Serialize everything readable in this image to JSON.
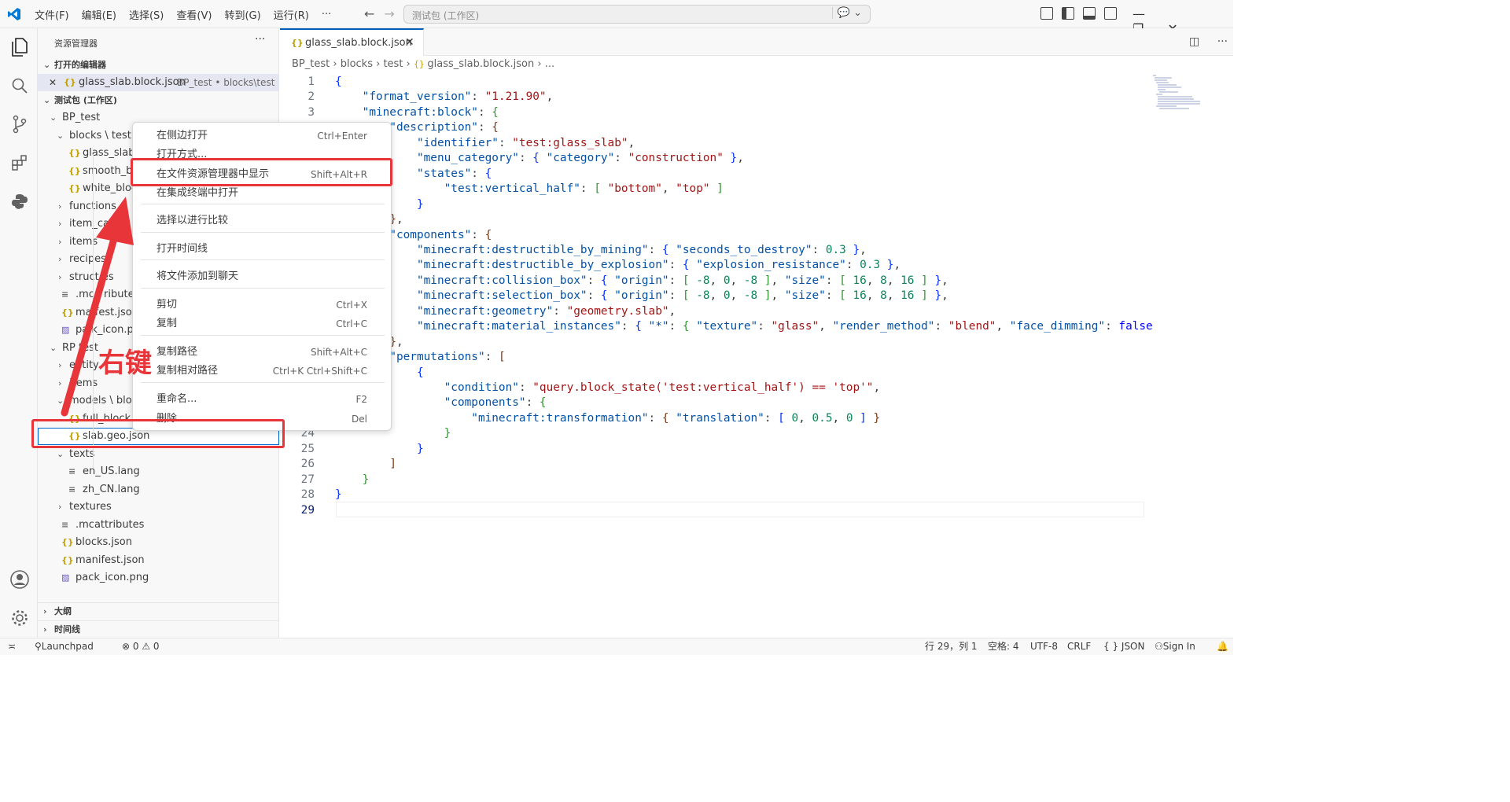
{
  "menu": [
    "文件(F)",
    "编辑(E)",
    "选择(S)",
    "查看(V)",
    "转到(G)",
    "运行(R)",
    "···"
  ],
  "search_placeholder": "测试包 (工作区)",
  "sidebar": {
    "title": "资源管理器",
    "more": "···",
    "open_editors": "打开的编辑器",
    "open_file": "glass_slab.block.json",
    "open_file_path": "BP_test • blocks\\test",
    "workspace": "测试包 (工作区)",
    "tree": [
      {
        "label": "BP_test",
        "kind": "folder-open",
        "indent": 1
      },
      {
        "label": "blocks \\ test",
        "kind": "folder-open",
        "indent": 2
      },
      {
        "label": "glass_slab.bl",
        "kind": "json",
        "indent": 3
      },
      {
        "label": "smooth_blo",
        "kind": "json",
        "indent": 3
      },
      {
        "label": "white_block.",
        "kind": "json",
        "indent": 3
      },
      {
        "label": "functions",
        "kind": "folder",
        "indent": 2
      },
      {
        "label": "item_ca",
        "kind": "folder",
        "indent": 2
      },
      {
        "label": "items",
        "kind": "folder",
        "indent": 2
      },
      {
        "label": "recipes",
        "kind": "folder",
        "indent": 2
      },
      {
        "label": "struct  es",
        "kind": "folder",
        "indent": 2
      },
      {
        "label": ".mca  ributes",
        "kind": "file",
        "indent": 2
      },
      {
        "label": "ma  fest.json",
        "kind": "json",
        "indent": 2
      },
      {
        "label": "pa  k_icon.png",
        "kind": "img",
        "indent": 2
      },
      {
        "label": "RP  test",
        "kind": "folder-open",
        "indent": 1
      },
      {
        "label": "entity",
        "kind": "folder",
        "indent": 2
      },
      {
        "label": "items",
        "kind": "folder",
        "indent": 2
      },
      {
        "label": "models \\ block",
        "kind": "folder-open",
        "indent": 2
      },
      {
        "label": "full_block.ge",
        "kind": "json",
        "indent": 3
      },
      {
        "label": "slab.geo.json",
        "kind": "json",
        "indent": 3
      },
      {
        "label": "texts",
        "kind": "folder-open",
        "indent": 2
      },
      {
        "label": "en_US.lang",
        "kind": "file",
        "indent": 3
      },
      {
        "label": "zh_CN.lang",
        "kind": "file",
        "indent": 3
      },
      {
        "label": "textures",
        "kind": "folder",
        "indent": 2
      },
      {
        "label": ".mcattributes",
        "kind": "file",
        "indent": 2
      },
      {
        "label": "blocks.json",
        "kind": "json",
        "indent": 2
      },
      {
        "label": "manifest.json",
        "kind": "json",
        "indent": 2
      },
      {
        "label": "pack_icon.png",
        "kind": "img",
        "indent": 2
      }
    ],
    "outline": "大纲",
    "timeline": "时间线"
  },
  "tab": {
    "label": "glass_slab.block.json",
    "close": "✕"
  },
  "breadcrumbs": [
    "BP_test",
    "blocks",
    "test",
    "glass_slab.block.json",
    "..."
  ],
  "code_lines": [
    [
      [
        "p1",
        "{"
      ]
    ],
    [
      [
        "",
        "    "
      ],
      [
        "k",
        "\"format_version\""
      ],
      [
        "",
        ": "
      ],
      [
        "s",
        "\"1.21.90\""
      ],
      [
        "",
        ","
      ]
    ],
    [
      [
        "",
        "    "
      ],
      [
        "k",
        "\"minecraft:block\""
      ],
      [
        "",
        ": "
      ],
      [
        "p2",
        "{"
      ]
    ],
    [
      [
        "",
        "        "
      ],
      [
        "k",
        "\"description\""
      ],
      [
        "",
        ": "
      ],
      [
        "p3",
        "{"
      ]
    ],
    [
      [
        "",
        "            "
      ],
      [
        "k",
        "\"identifier\""
      ],
      [
        "",
        ": "
      ],
      [
        "s",
        "\"test:glass_slab\""
      ],
      [
        "",
        ","
      ]
    ],
    [
      [
        "",
        "            "
      ],
      [
        "k",
        "\"menu_category\""
      ],
      [
        "",
        ": "
      ],
      [
        "p1",
        "{ "
      ],
      [
        "k",
        "\"category\""
      ],
      [
        "",
        ": "
      ],
      [
        "s",
        "\"construction\""
      ],
      [
        "p1",
        " }"
      ],
      [
        "",
        ","
      ]
    ],
    [
      [
        "",
        "            "
      ],
      [
        "k",
        "\"states\""
      ],
      [
        "",
        ": "
      ],
      [
        "p1",
        "{"
      ]
    ],
    [
      [
        "",
        "                "
      ],
      [
        "k",
        "\"test:vertical_half\""
      ],
      [
        "",
        ": "
      ],
      [
        "p2",
        "[ "
      ],
      [
        "s",
        "\"bottom\""
      ],
      [
        "",
        ", "
      ],
      [
        "s",
        "\"top\""
      ],
      [
        "p2",
        " ]"
      ]
    ],
    [
      [
        "",
        "            "
      ],
      [
        "p1",
        "}"
      ]
    ],
    [
      [
        "",
        "        "
      ],
      [
        "p3",
        "}"
      ],
      [
        "",
        ","
      ]
    ],
    [
      [
        "",
        "        "
      ],
      [
        "k",
        "\"components\""
      ],
      [
        "",
        ": "
      ],
      [
        "p3",
        "{"
      ]
    ],
    [
      [
        "",
        "            "
      ],
      [
        "k",
        "\"minecraft:destructible_by_mining\""
      ],
      [
        "",
        ": "
      ],
      [
        "p1",
        "{ "
      ],
      [
        "k",
        "\"seconds_to_destroy\""
      ],
      [
        "",
        ": "
      ],
      [
        "n",
        "0.3"
      ],
      [
        "p1",
        " }"
      ],
      [
        "",
        ","
      ]
    ],
    [
      [
        "",
        "            "
      ],
      [
        "k",
        "\"minecraft:destructible_by_explosion\""
      ],
      [
        "",
        ": "
      ],
      [
        "p1",
        "{ "
      ],
      [
        "k",
        "\"explosion_resistance\""
      ],
      [
        "",
        ": "
      ],
      [
        "n",
        "0.3"
      ],
      [
        "p1",
        " }"
      ],
      [
        "",
        ","
      ]
    ],
    [
      [
        "",
        "            "
      ],
      [
        "k",
        "\"minecraft:collision_box\""
      ],
      [
        "",
        ": "
      ],
      [
        "p1",
        "{ "
      ],
      [
        "k",
        "\"origin\""
      ],
      [
        "",
        ": "
      ],
      [
        "p2",
        "[ "
      ],
      [
        "n",
        "-8"
      ],
      [
        "",
        ", "
      ],
      [
        "n",
        "0"
      ],
      [
        "",
        ", "
      ],
      [
        "n",
        "-8"
      ],
      [
        "p2",
        " ]"
      ],
      [
        "",
        ", "
      ],
      [
        "k",
        "\"size\""
      ],
      [
        "",
        ": "
      ],
      [
        "p2",
        "[ "
      ],
      [
        "n",
        "16"
      ],
      [
        "",
        ", "
      ],
      [
        "n",
        "8"
      ],
      [
        "",
        ", "
      ],
      [
        "n",
        "16"
      ],
      [
        "p2",
        " ]"
      ],
      [
        "p1",
        " }"
      ],
      [
        "",
        ","
      ]
    ],
    [
      [
        "",
        "            "
      ],
      [
        "k",
        "\"minecraft:selection_box\""
      ],
      [
        "",
        ": "
      ],
      [
        "p1",
        "{ "
      ],
      [
        "k",
        "\"origin\""
      ],
      [
        "",
        ": "
      ],
      [
        "p2",
        "[ "
      ],
      [
        "n",
        "-8"
      ],
      [
        "",
        ", "
      ],
      [
        "n",
        "0"
      ],
      [
        "",
        ", "
      ],
      [
        "n",
        "-8"
      ],
      [
        "p2",
        " ]"
      ],
      [
        "",
        ", "
      ],
      [
        "k",
        "\"size\""
      ],
      [
        "",
        ": "
      ],
      [
        "p2",
        "[ "
      ],
      [
        "n",
        "16"
      ],
      [
        "",
        ", "
      ],
      [
        "n",
        "8"
      ],
      [
        "",
        ", "
      ],
      [
        "n",
        "16"
      ],
      [
        "p2",
        " ]"
      ],
      [
        "p1",
        " }"
      ],
      [
        "",
        ","
      ]
    ],
    [
      [
        "",
        "            "
      ],
      [
        "k",
        "\"minecraft:geometry\""
      ],
      [
        "",
        ": "
      ],
      [
        "s",
        "\"geometry.slab\""
      ],
      [
        "",
        ","
      ]
    ],
    [
      [
        "",
        "            "
      ],
      [
        "k",
        "\"minecraft:material_instances\""
      ],
      [
        "",
        ": "
      ],
      [
        "p1",
        "{ "
      ],
      [
        "k",
        "\"*\""
      ],
      [
        "",
        ": "
      ],
      [
        "p2",
        "{ "
      ],
      [
        "k",
        "\"texture\""
      ],
      [
        "",
        ": "
      ],
      [
        "s",
        "\"glass\""
      ],
      [
        "",
        ", "
      ],
      [
        "k",
        "\"render_method\""
      ],
      [
        "",
        ": "
      ],
      [
        "s",
        "\"blend\""
      ],
      [
        "",
        ", "
      ],
      [
        "k",
        "\"face_dimming\""
      ],
      [
        "",
        ": "
      ],
      [
        "b",
        "false"
      ]
    ],
    [
      [
        "",
        "        "
      ],
      [
        "p3",
        "}"
      ],
      [
        "",
        ","
      ]
    ],
    [
      [
        "",
        "        "
      ],
      [
        "k",
        "\"permutations\""
      ],
      [
        "",
        ": "
      ],
      [
        "p3",
        "["
      ]
    ],
    [
      [
        "",
        "            "
      ],
      [
        "p1",
        "{"
      ]
    ],
    [
      [
        "",
        "                "
      ],
      [
        "k",
        "\"condition\""
      ],
      [
        "",
        ": "
      ],
      [
        "s",
        "\"query.block_state('test:vertical_half') == 'top'\""
      ],
      [
        "",
        ","
      ]
    ],
    [
      [
        "",
        "                "
      ],
      [
        "k",
        "\"components\""
      ],
      [
        "",
        ": "
      ],
      [
        "p2",
        "{"
      ]
    ],
    [
      [
        "",
        "                    "
      ],
      [
        "k",
        "\"minecraft:transformation\""
      ],
      [
        "",
        ": "
      ],
      [
        "p3",
        "{ "
      ],
      [
        "k",
        "\"translation\""
      ],
      [
        "",
        ": "
      ],
      [
        "p1",
        "[ "
      ],
      [
        "n",
        "0"
      ],
      [
        "",
        ", "
      ],
      [
        "n",
        "0.5"
      ],
      [
        "",
        ", "
      ],
      [
        "n",
        "0"
      ],
      [
        "p1",
        " ]"
      ],
      [
        "p3",
        " }"
      ]
    ],
    [
      [
        "",
        "                "
      ],
      [
        "p2",
        "}"
      ]
    ],
    [
      [
        "",
        "            "
      ],
      [
        "p1",
        "}"
      ]
    ],
    [
      [
        "",
        "        "
      ],
      [
        "p3",
        "]"
      ]
    ],
    [
      [
        "",
        "    "
      ],
      [
        "p2",
        "}"
      ]
    ],
    [
      [
        "p1",
        "}"
      ]
    ],
    [
      [
        "",
        ""
      ]
    ]
  ],
  "context_menu": [
    {
      "label": "在侧边打开",
      "shortcut": "Ctrl+Enter"
    },
    {
      "label": "打开方式...",
      "shortcut": ""
    },
    {
      "label": "在文件资源管理器中显示",
      "shortcut": "Shift+Alt+R"
    },
    {
      "label": "在集成终端中打开",
      "shortcut": ""
    },
    {
      "label": "选择以进行比较",
      "shortcut": ""
    },
    {
      "label": "打开时间线",
      "shortcut": ""
    },
    {
      "label": "将文件添加到聊天",
      "shortcut": ""
    },
    {
      "label": "剪切",
      "shortcut": "Ctrl+X"
    },
    {
      "label": "复制",
      "shortcut": "Ctrl+C"
    },
    {
      "label": "复制路径",
      "shortcut": "Shift+Alt+C"
    },
    {
      "label": "复制相对路径",
      "shortcut": "Ctrl+K Ctrl+Shift+C"
    },
    {
      "label": "重命名...",
      "shortcut": "F2"
    },
    {
      "label": "删除",
      "shortcut": "Del"
    }
  ],
  "annotation": "右键",
  "status": {
    "launchpad": "Launchpad",
    "problems": "⊗ 0 ⚠ 0",
    "position": "行 29，列 1",
    "spaces": "空格: 4",
    "encoding": "UTF-8",
    "eol": "CRLF",
    "language": "{ } JSON",
    "signin": "Sign In"
  },
  "colors": {
    "accent": "#005fb8",
    "annotation": "#e8353a"
  }
}
